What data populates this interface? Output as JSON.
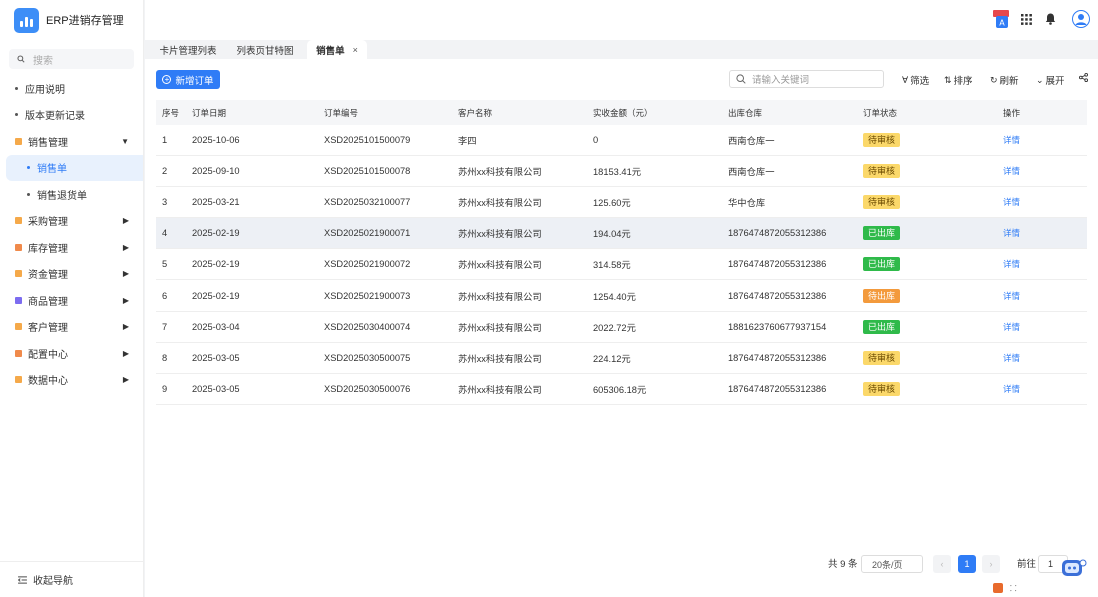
{
  "app": {
    "title": "ERP进销存管理"
  },
  "sidebar": {
    "search_placeholder": "搜索",
    "items": [
      {
        "label": "应用说明",
        "kind": "dot"
      },
      {
        "label": "版本更新记录",
        "kind": "dot"
      },
      {
        "label": "销售管理",
        "kind": "group",
        "color": "#f5a94a",
        "expanded": true
      },
      {
        "label": "销售单",
        "kind": "sub",
        "active": true
      },
      {
        "label": "销售退货单",
        "kind": "sub"
      },
      {
        "label": "采购管理",
        "kind": "group",
        "color": "#f5a94a"
      },
      {
        "label": "库存管理",
        "kind": "group",
        "color": "#f08a4b"
      },
      {
        "label": "资金管理",
        "kind": "group",
        "color": "#f5a94a"
      },
      {
        "label": "商品管理",
        "kind": "group",
        "color": "#7c6cf0"
      },
      {
        "label": "客户管理",
        "kind": "group",
        "color": "#f5a94a"
      },
      {
        "label": "配置中心",
        "kind": "group",
        "color": "#f08a4b"
      },
      {
        "label": "数据中心",
        "kind": "group",
        "color": "#f5a94a"
      }
    ],
    "collapse_label": "收起导航"
  },
  "tabs": [
    {
      "label": "卡片管理列表"
    },
    {
      "label": "列表页甘特图"
    },
    {
      "label": "销售单",
      "active": true,
      "close": "×"
    }
  ],
  "toolbar": {
    "add_label": "新增订单",
    "search_placeholder": "请输入关键词",
    "filter_label": "筛选",
    "sort_label": "排序",
    "refresh_label": "刷新",
    "expand_label": "展开"
  },
  "table": {
    "headers": [
      "序号",
      "订单日期",
      "订单编号",
      "客户名称",
      "实收金额（元）",
      "出库仓库",
      "订单状态",
      "操作"
    ],
    "rows": [
      [
        "1",
        "2025-10-06",
        "XSD2025101500079",
        "李四",
        "0",
        "西南仓库一",
        "待审核",
        "详情"
      ],
      [
        "2",
        "2025-09-10",
        "XSD2025101500078",
        "苏州xx科技有限公司",
        "18153.41元",
        "西南仓库一",
        "待审核",
        "详情"
      ],
      [
        "3",
        "2025-03-21",
        "XSD2025032100077",
        "苏州xx科技有限公司",
        "125.60元",
        "华中仓库",
        "待审核",
        "详情"
      ],
      [
        "4",
        "2025-02-19",
        "XSD2025021900071",
        "苏州xx科技有限公司",
        "194.04元",
        "1876474872055312386",
        "已出库",
        "详情"
      ],
      [
        "5",
        "2025-02-19",
        "XSD2025021900072",
        "苏州xx科技有限公司",
        "314.58元",
        "1876474872055312386",
        "已出库",
        "详情"
      ],
      [
        "6",
        "2025-02-19",
        "XSD2025021900073",
        "苏州xx科技有限公司",
        "1254.40元",
        "1876474872055312386",
        "待出库",
        "详情"
      ],
      [
        "7",
        "2025-03-04",
        "XSD2025030400074",
        "苏州xx科技有限公司",
        "2022.72元",
        "1881623760677937154",
        "已出库",
        "详情"
      ],
      [
        "8",
        "2025-03-05",
        "XSD2025030500075",
        "苏州xx科技有限公司",
        "224.12元",
        "1876474872055312386",
        "待审核",
        "详情"
      ],
      [
        "9",
        "2025-03-05",
        "XSD2025030500076",
        "苏州xx科技有限公司",
        "605306.18元",
        "1876474872055312386",
        "待审核",
        "详情"
      ]
    ]
  },
  "status_styles": {
    "待审核": "b-pending",
    "已出库": "b-out",
    "待出库": "b-waitout"
  },
  "pagination": {
    "total": "共 9 条",
    "page_size": "20条/页",
    "prev": "‹",
    "current": "1",
    "next": "›",
    "goto_label": "前往",
    "goto_value": "1"
  }
}
